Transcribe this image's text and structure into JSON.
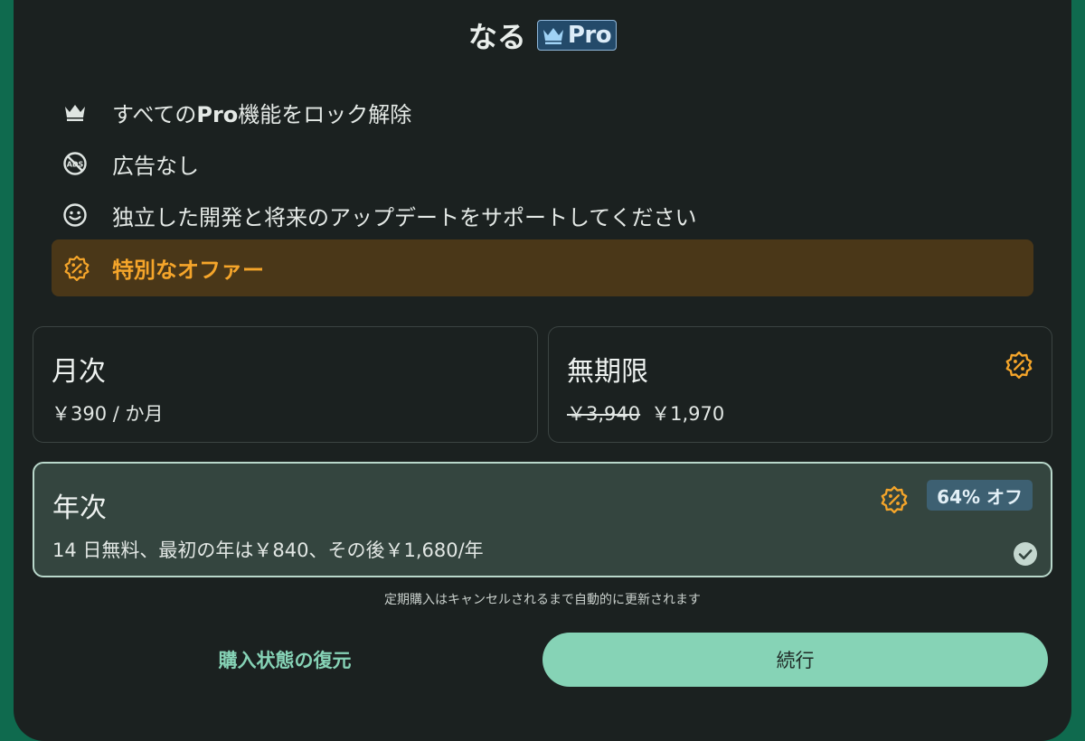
{
  "header": {
    "title": "なる",
    "badge_label": "Pro"
  },
  "features": [
    {
      "icon": "crown-icon",
      "label_prefix": "すべての",
      "label_bold": "Pro",
      "label_suffix": "機能をロック解除"
    },
    {
      "icon": "no-ads-icon",
      "label": "広告なし"
    },
    {
      "icon": "smiley-icon",
      "label": "独立した開発と将来のアップデートをサポートしてください"
    }
  ],
  "special_offer": {
    "icon": "discount-badge-icon",
    "label": "特別なオファー",
    "color": "#f5a52a",
    "background": "#4a3718"
  },
  "plans": {
    "monthly": {
      "name": "月次",
      "price": "￥390 / か月",
      "selected": false
    },
    "lifetime": {
      "name": "無期限",
      "old_price": "￥3,940",
      "price": "￥1,970",
      "selected": false,
      "icon": "discount-badge-icon"
    },
    "yearly": {
      "name": "年次",
      "price": "14 日無料、最初の年は￥840、その後￥1,680/年",
      "discount": "64% オフ",
      "selected": true,
      "icon": "discount-badge-icon",
      "check_icon": "check-circle-icon"
    }
  },
  "notice": "定期購入はキャンセルされるまで自動的に更新されます",
  "actions": {
    "restore_label": "購入状態の復元",
    "continue_label": "続行"
  },
  "colors": {
    "accent": "#86d3b6",
    "offer": "#f5a52a",
    "badge": "#3d6072",
    "background": "#1b2120",
    "outer": "#0f6a4e"
  }
}
